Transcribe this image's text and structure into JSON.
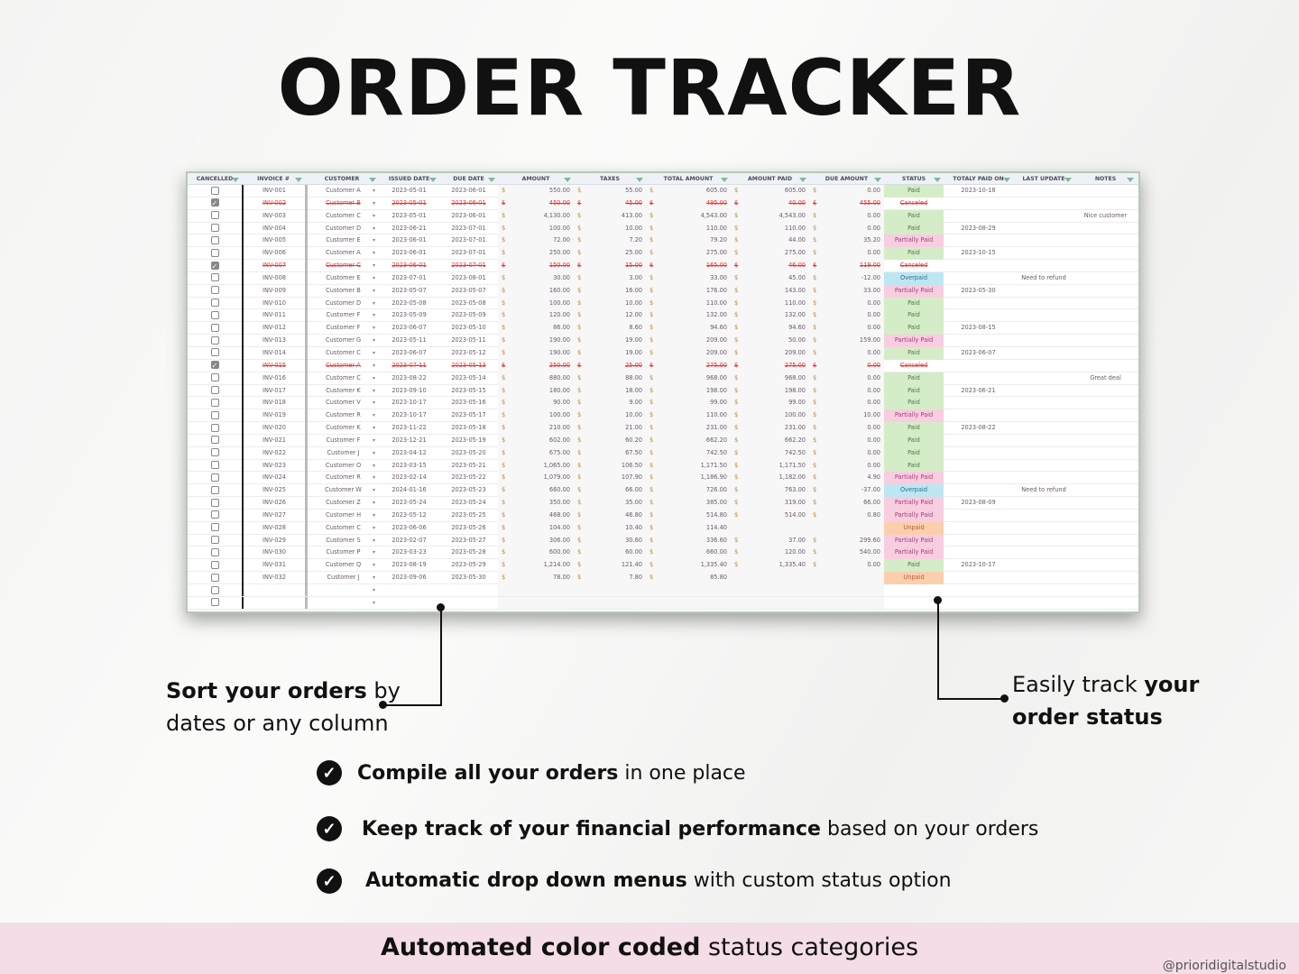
{
  "title": "ORDER TRACKER",
  "sheet": {
    "headers": [
      "CANCELLED",
      "INVOICE #",
      "CUSTOMER",
      "ISSUED DATE",
      "DUE DATE",
      "AMOUNT",
      "TAXES",
      "TOTAL AMOUNT",
      "AMOUNT PAID",
      "DUE AMOUNT",
      "STATUS",
      "TOTALY PAID ON",
      "LAST UPDATE",
      "NOTES"
    ],
    "currency": "$",
    "rows": [
      [
        false,
        "INV-001",
        "Customer A",
        "2023-05-01",
        "2023-06-01",
        "550.00",
        "55.00",
        "605.00",
        "605.00",
        "0.00",
        "Paid",
        "2023-10-18",
        "",
        ""
      ],
      [
        true,
        "INV-002",
        "Customer B",
        "2023-05-01",
        "2023-06-01",
        "450.00",
        "45.00",
        "495.00",
        "40.00",
        "455.00",
        "Canceled",
        "",
        "",
        ""
      ],
      [
        false,
        "INV-003",
        "Customer C",
        "2023-05-01",
        "2023-06-01",
        "4,130.00",
        "413.00",
        "4,543.00",
        "4,543.00",
        "0.00",
        "Paid",
        "",
        "",
        "Nice customer"
      ],
      [
        false,
        "INV-004",
        "Customer D",
        "2023-06-21",
        "2023-07-01",
        "100.00",
        "10.00",
        "110.00",
        "110.00",
        "0.00",
        "Paid",
        "2023-08-29",
        "",
        ""
      ],
      [
        false,
        "INV-005",
        "Customer E",
        "2023-06-01",
        "2023-07-01",
        "72.00",
        "7.20",
        "79.20",
        "44.00",
        "35.20",
        "Partially Paid",
        "",
        "",
        ""
      ],
      [
        false,
        "INV-006",
        "Customer A",
        "2023-06-01",
        "2023-07-01",
        "250.00",
        "25.00",
        "275.00",
        "275.00",
        "0.00",
        "Paid",
        "2023-10-15",
        "",
        ""
      ],
      [
        true,
        "INV-007",
        "Customer C",
        "2023-06-01",
        "2023-07-01",
        "150.00",
        "15.00",
        "165.00",
        "46.00",
        "119.00",
        "Canceled",
        "",
        "",
        ""
      ],
      [
        false,
        "INV-008",
        "Customer E",
        "2023-07-01",
        "2023-08-01",
        "30.00",
        "3.00",
        "33.00",
        "45.00",
        "-12.00",
        "Overpaid",
        "",
        "Need to refund",
        ""
      ],
      [
        false,
        "INV-009",
        "Customer B",
        "2023-05-07",
        "2023-05-07",
        "160.00",
        "16.00",
        "176.00",
        "143.00",
        "33.00",
        "Partially Paid",
        "2023-05-30",
        "",
        ""
      ],
      [
        false,
        "INV-010",
        "Customer D",
        "2023-05-08",
        "2023-05-08",
        "100.00",
        "10.00",
        "110.00",
        "110.00",
        "0.00",
        "Paid",
        "",
        "",
        ""
      ],
      [
        false,
        "INV-011",
        "Customer F",
        "2023-05-09",
        "2023-05-09",
        "120.00",
        "12.00",
        "132.00",
        "132.00",
        "0.00",
        "Paid",
        "",
        "",
        ""
      ],
      [
        false,
        "INV-012",
        "Customer F",
        "2023-06-07",
        "2023-05-10",
        "86.00",
        "8.60",
        "94.60",
        "94.60",
        "0.00",
        "Paid",
        "2023-08-15",
        "",
        ""
      ],
      [
        false,
        "INV-013",
        "Customer G",
        "2023-05-11",
        "2023-05-11",
        "190.00",
        "19.00",
        "209.00",
        "50.00",
        "159.00",
        "Partially Paid",
        "",
        "",
        ""
      ],
      [
        false,
        "INV-014",
        "Customer C",
        "2023-06-07",
        "2023-05-12",
        "190.00",
        "19.00",
        "209.00",
        "209.00",
        "0.00",
        "Paid",
        "2023-06-07",
        "",
        ""
      ],
      [
        true,
        "INV-015",
        "Customer A",
        "2023-07-11",
        "2023-05-13",
        "250.00",
        "25.00",
        "275.00",
        "275.00",
        "0.00",
        "Canceled",
        "",
        "",
        ""
      ],
      [
        false,
        "INV-016",
        "Customer C",
        "2023-08-22",
        "2023-05-14",
        "880.00",
        "88.00",
        "968.00",
        "968.00",
        "0.00",
        "Paid",
        "",
        "",
        "Great deal"
      ],
      [
        false,
        "INV-017",
        "Customer K",
        "2023-09-10",
        "2023-05-15",
        "180.00",
        "18.00",
        "198.00",
        "198.00",
        "0.00",
        "Paid",
        "2023-06-21",
        "",
        ""
      ],
      [
        false,
        "INV-018",
        "Customer V",
        "2023-10-17",
        "2023-05-16",
        "90.00",
        "9.00",
        "99.00",
        "99.00",
        "0.00",
        "Paid",
        "",
        "",
        ""
      ],
      [
        false,
        "INV-019",
        "Customer R",
        "2023-10-17",
        "2023-05-17",
        "100.00",
        "10.00",
        "110.00",
        "100.00",
        "10.00",
        "Partially Paid",
        "",
        "",
        ""
      ],
      [
        false,
        "INV-020",
        "Customer K",
        "2023-11-22",
        "2023-05-18",
        "210.00",
        "21.00",
        "231.00",
        "231.00",
        "0.00",
        "Paid",
        "2023-08-22",
        "",
        ""
      ],
      [
        false,
        "INV-021",
        "Customer F",
        "2023-12-21",
        "2023-05-19",
        "602.00",
        "60.20",
        "662.20",
        "662.20",
        "0.00",
        "Paid",
        "",
        "",
        ""
      ],
      [
        false,
        "INV-022",
        "Customer J",
        "2023-04-12",
        "2023-05-20",
        "675.00",
        "67.50",
        "742.50",
        "742.50",
        "0.00",
        "Paid",
        "",
        "",
        ""
      ],
      [
        false,
        "INV-023",
        "Customer O",
        "2023-03-15",
        "2023-05-21",
        "1,065.00",
        "106.50",
        "1,171.50",
        "1,171.50",
        "0.00",
        "Paid",
        "",
        "",
        ""
      ],
      [
        false,
        "INV-024",
        "Customer R",
        "2023-02-14",
        "2023-05-22",
        "1,079.00",
        "107.90",
        "1,186.90",
        "1,182.00",
        "4.90",
        "Partially Paid",
        "",
        "",
        ""
      ],
      [
        false,
        "INV-025",
        "Customer W",
        "2024-01-16",
        "2023-05-23",
        "660.00",
        "66.00",
        "726.00",
        "763.00",
        "-37.00",
        "Overpaid",
        "",
        "Need to refund",
        ""
      ],
      [
        false,
        "INV-026",
        "Customer Z",
        "2023-05-24",
        "2023-05-24",
        "350.00",
        "35.00",
        "385.00",
        "319.00",
        "66.00",
        "Partially Paid",
        "2023-08-09",
        "",
        ""
      ],
      [
        false,
        "INV-027",
        "Customer H",
        "2023-05-12",
        "2023-05-25",
        "468.00",
        "46.80",
        "514.80",
        "514.00",
        "0.80",
        "Partially Paid",
        "",
        "",
        ""
      ],
      [
        false,
        "INV-028",
        "Customer C",
        "2023-06-06",
        "2023-05-26",
        "104.00",
        "10.40",
        "114.40",
        "",
        "",
        "Unpaid",
        "",
        "",
        ""
      ],
      [
        false,
        "INV-029",
        "Customer S",
        "2023-02-07",
        "2023-05-27",
        "306.00",
        "30.60",
        "336.60",
        "37.00",
        "299.60",
        "Partially Paid",
        "",
        "",
        ""
      ],
      [
        false,
        "INV-030",
        "Customer P",
        "2023-03-23",
        "2023-05-28",
        "600.00",
        "60.00",
        "660.00",
        "120.00",
        "540.00",
        "Partially Paid",
        "",
        "",
        ""
      ],
      [
        false,
        "INV-031",
        "Customer Q",
        "2023-08-19",
        "2023-05-29",
        "1,214.00",
        "121.40",
        "1,335.40",
        "1,335.40",
        "0.00",
        "Paid",
        "2023-10-17",
        "",
        ""
      ],
      [
        false,
        "INV-032",
        "Customer J",
        "2023-09-06",
        "2023-05-30",
        "78.00",
        "7.80",
        "85.80",
        "",
        "",
        "Unpaid",
        "",
        "",
        ""
      ]
    ],
    "empty_rows": 2
  },
  "callouts": {
    "left": {
      "bold": "Sort your orders",
      "rest1": " by",
      "line2": "dates or any column"
    },
    "right": {
      "plain": "Easily track ",
      "bold1": "your",
      "bold2": "order status"
    }
  },
  "features": [
    {
      "bold": "Compile all your orders",
      "rest": " in one place",
      "icon": "check-circle-icon"
    },
    {
      "bold": "Keep track of your financial performance",
      "rest": " based on your orders",
      "icon": "check-circle-icon"
    },
    {
      "bold": "Automatic drop down menus",
      "rest": " with custom status option",
      "icon": "check-circle-icon"
    }
  ],
  "banner": {
    "bold": "Automated color coded",
    "rest": " status categories"
  },
  "watermark": "@prioridigitalstudio",
  "colors": {
    "paid": "#d5ecc8",
    "partially_paid": "#f8cde0",
    "overpaid": "#bde6f2",
    "unpaid": "#fbcfae",
    "canceled": "#ee3333",
    "banner": "#f4dde7"
  }
}
